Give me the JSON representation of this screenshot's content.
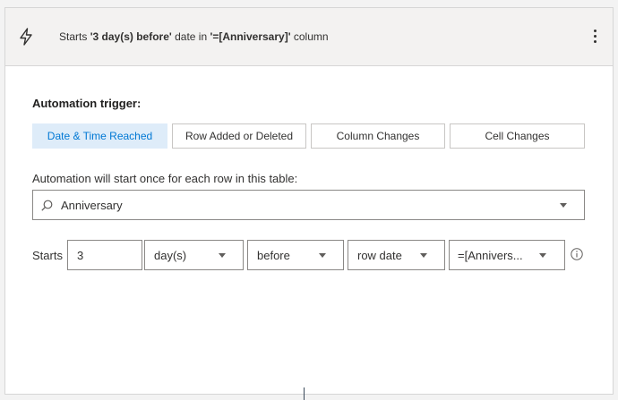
{
  "header": {
    "summary_prefix": "Starts ",
    "summary_offset": "'3 day(s) before'",
    "summary_mid": " date in ",
    "summary_column": "'=[Anniversary]'",
    "summary_suffix": " column"
  },
  "trigger": {
    "title": "Automation trigger:",
    "tabs": [
      {
        "label": "Date & Time Reached",
        "active": true
      },
      {
        "label": "Row Added or Deleted",
        "active": false
      },
      {
        "label": "Column Changes",
        "active": false
      },
      {
        "label": "Cell Changes",
        "active": false
      }
    ]
  },
  "table_select": {
    "label": "Automation will start once for each row in this table:",
    "value": "Anniversary"
  },
  "schedule": {
    "starts_label": "Starts",
    "amount": "3",
    "unit": "day(s)",
    "direction": "before",
    "reference": "row date",
    "column": "=[Annivers..."
  },
  "colors": {
    "active_tab_bg": "#deecf9",
    "active_tab_text": "#0078d4"
  }
}
